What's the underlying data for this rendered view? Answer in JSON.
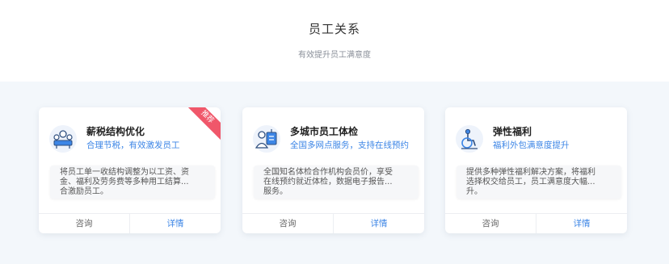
{
  "header": {
    "title": "员工关系",
    "subtitle": "有效提升员工满意度"
  },
  "cards": [
    {
      "title": "薪税结构优化",
      "subtitle": "合理节税，有效激发员工",
      "desc_lines": [
        "将员工单一收结构调整为以工资、资",
        "金、福利及劳务费等多种用工结算...",
        "合激励员工。"
      ],
      "consult": "咨询",
      "details": "详情",
      "badge": "推荐",
      "icon": "meeting-table-icon"
    },
    {
      "title": "多城市员工体检",
      "subtitle": "全国多网点服务，支持在线预约",
      "desc_lines": [
        "全国知名体检合作机构会员价，享受",
        "在线预约就近体检，数据电子报告...",
        "服务。"
      ],
      "consult": "咨询",
      "details": "详情",
      "icon": "medical-checkup-icon"
    },
    {
      "title": "弹性福利",
      "subtitle": "福利外包满意度提升",
      "desc_lines": [
        "提供多种弹性福利解决方案，将福利",
        "选择权交给员工，员工满意度大幅...",
        "升。"
      ],
      "consult": "咨询",
      "details": "详情",
      "icon": "wheelchair-icon"
    }
  ],
  "colors": {
    "accent": "#3d86e6",
    "badge": "#f0576a",
    "band_bg": "#f3f7fb"
  }
}
